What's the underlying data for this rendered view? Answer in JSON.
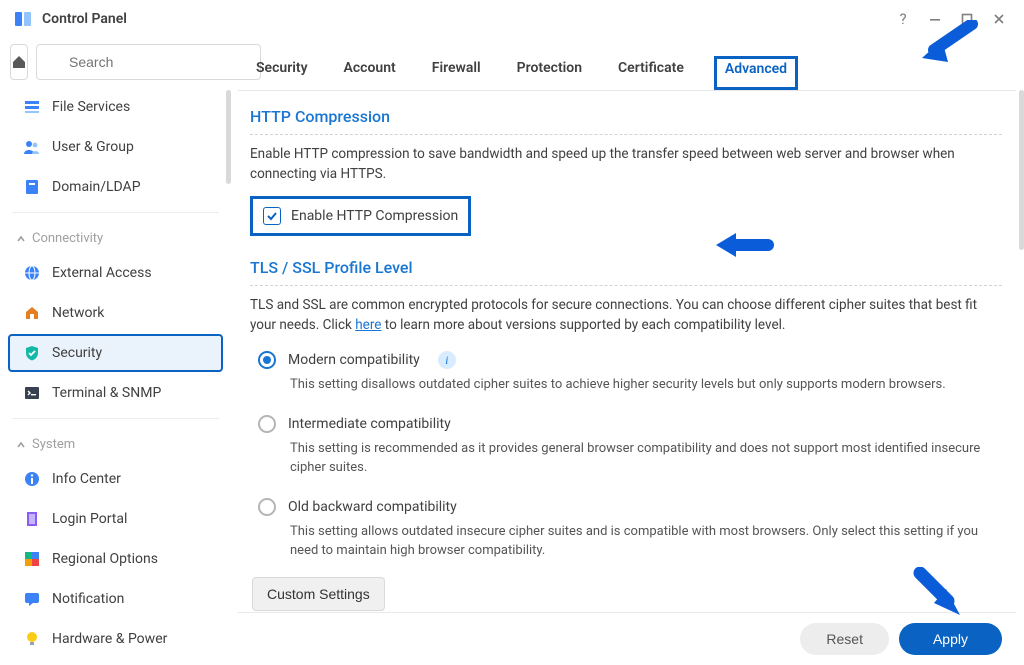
{
  "title": "Control Panel",
  "search_placeholder": "Search",
  "sidebar": {
    "items": [
      {
        "label": "File Services",
        "icon": "list"
      },
      {
        "label": "User & Group",
        "icon": "users"
      },
      {
        "label": "Domain/LDAP",
        "icon": "ldap"
      }
    ],
    "groups": [
      {
        "name": "Connectivity",
        "items": [
          {
            "label": "External Access",
            "icon": "globe"
          },
          {
            "label": "Network",
            "icon": "house"
          },
          {
            "label": "Security",
            "icon": "shield",
            "active": true
          },
          {
            "label": "Terminal & SNMP",
            "icon": "terminal"
          }
        ]
      },
      {
        "name": "System",
        "items": [
          {
            "label": "Info Center",
            "icon": "info"
          },
          {
            "label": "Login Portal",
            "icon": "door"
          },
          {
            "label": "Regional Options",
            "icon": "region"
          },
          {
            "label": "Notification",
            "icon": "chat"
          },
          {
            "label": "Hardware & Power",
            "icon": "bulb"
          }
        ]
      }
    ]
  },
  "tabs": [
    "Security",
    "Account",
    "Firewall",
    "Protection",
    "Certificate",
    "Advanced"
  ],
  "active_tab": "Advanced",
  "http_compression": {
    "title": "HTTP Compression",
    "desc": "Enable HTTP compression to save bandwidth and speed up the transfer speed between web server and browser when connecting via HTTPS.",
    "checkbox_label": "Enable HTTP Compression",
    "checked": true
  },
  "tls": {
    "title": "TLS / SSL Profile Level",
    "desc_pre": "TLS and SSL are common encrypted protocols for secure connections. You can choose different cipher suites that best fit your needs. Click ",
    "desc_link": "here",
    "desc_post": " to learn more about versions supported by each compatibility level.",
    "options": [
      {
        "label": "Modern compatibility",
        "desc": "This setting disallows outdated cipher suites to achieve higher security levels but only supports modern browsers.",
        "checked": true,
        "info": true
      },
      {
        "label": "Intermediate compatibility",
        "desc": "This setting is recommended as it provides general browser compatibility and does not support most identified insecure cipher suites.",
        "checked": false
      },
      {
        "label": "Old backward compatibility",
        "desc": "This setting allows outdated insecure cipher suites and is compatible with most browsers. Only select this setting if you need to maintain high browser compatibility.",
        "checked": false
      }
    ],
    "custom_btn": "Custom Settings"
  },
  "footer": {
    "reset": "Reset",
    "apply": "Apply"
  }
}
